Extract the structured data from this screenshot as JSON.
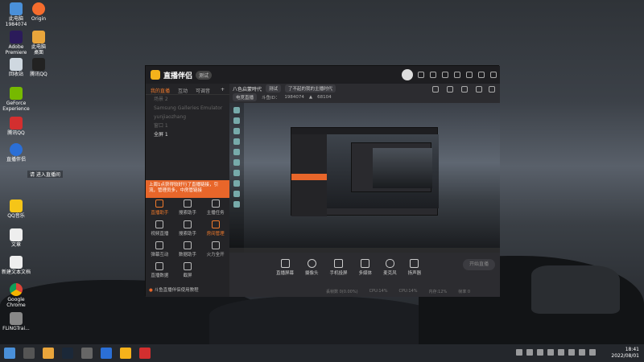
{
  "desktop": {
    "icons": [
      {
        "label": "此电脑\n1984074"
      },
      {
        "label": "Origin"
      },
      {
        "label": "Adobe\nPremiere"
      },
      {
        "label": "此电脑\n桌面"
      },
      {
        "label": "回收站"
      },
      {
        "label": "腾讯QQ"
      },
      {
        "label": "GeForce\nExperience"
      },
      {
        "label": "腾讯QQ"
      },
      {
        "label": "直播伴侣"
      },
      {
        "label": "QQ音乐"
      },
      {
        "label": "文章"
      },
      {
        "label": "新建文本文档"
      },
      {
        "label": "Google\nChrome"
      },
      {
        "label": "FLiNGTrai..."
      }
    ],
    "notice": "请 进入直播间"
  },
  "app": {
    "title": "直播伴侣",
    "version": "测试",
    "tabs": [
      "我的直播",
      "互动",
      "可调音"
    ],
    "scenes": [
      "场景 2",
      "Samsung Galleries Emulator",
      "yunjiaozhang",
      "窗口 1",
      "全屏 1"
    ],
    "promo": "上周1点获得较好行了直播链接，引流，管理员多，中房管链接",
    "tools": [
      {
        "label": "直播助手"
      },
      {
        "label": "搜索助手"
      },
      {
        "label": "主播任务"
      },
      {
        "label": "视频直播"
      },
      {
        "label": "搜索助手"
      },
      {
        "label": "房间管理"
      },
      {
        "label": "弹幕互动"
      },
      {
        "label": "数据助手"
      },
      {
        "label": "火力全开"
      },
      {
        "label": "直播数据"
      },
      {
        "label": "截屏"
      }
    ],
    "footer_link": "斗鱼直播伴侣使用教程",
    "stream_title": "八色启蒙時代",
    "tags": [
      "测试",
      "了不起的我的主播时代"
    ],
    "category_tag": "电竞直播",
    "room_label": "斗鱼ID：",
    "room_id": "1984074",
    "viewers": "68104",
    "controls": [
      "直播屏幕",
      "摄像头",
      "手机投屏",
      "多媒体",
      "麦克风",
      "扬声器"
    ],
    "start_button": "开始直播",
    "stats": [
      "丢帧数 0(0.00%)",
      "CPU:14%",
      "CPU:14%",
      "内存:12%",
      "帧率 0"
    ]
  },
  "taskbar": {
    "time": "18:41",
    "date": "2022/08/01"
  }
}
